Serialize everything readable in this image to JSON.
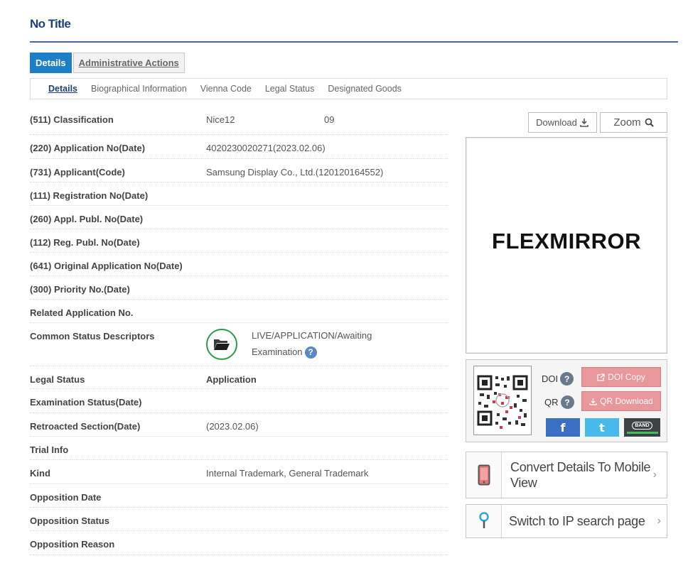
{
  "page": {
    "title": "No Title"
  },
  "main_tabs": [
    {
      "label": "Details"
    },
    {
      "label": "Administrative Actions"
    }
  ],
  "sub_tabs": [
    {
      "label": "Details"
    },
    {
      "label": "Biographical Information"
    },
    {
      "label": "Vienna Code"
    },
    {
      "label": "Legal Status"
    },
    {
      "label": "Designated Goods"
    }
  ],
  "rows": [
    {
      "label": "(511) Classification",
      "value_a": "Nice12",
      "value_b": "09"
    },
    {
      "label": "(220) Application No(Date)",
      "value": "4020230020271(2023.02.06)"
    },
    {
      "label": "(731) Applicant(Code)",
      "value": "Samsung Display Co., Ltd.(120120164552)"
    },
    {
      "label": "(111) Registration No(Date)",
      "value": ""
    },
    {
      "label": "(260) Appl. Publ. No(Date)",
      "value": ""
    },
    {
      "label": "(112) Reg. Publ. No(Date)",
      "value": ""
    },
    {
      "label": "(641) Original Application No(Date)",
      "value": ""
    },
    {
      "label": "(300) Priority No.(Date)",
      "value": ""
    },
    {
      "label": "Related Application No.",
      "value": ""
    },
    {
      "label": "Common Status Descriptors",
      "value": "LIVE/APPLICATION/Awaiting Examination"
    },
    {
      "label": "Legal Status",
      "value": "Application"
    },
    {
      "label": "Examination Status(Date)",
      "value": ""
    },
    {
      "label": "Retroacted Section(Date)",
      "value": "(2023.02.06)"
    },
    {
      "label": "Trial Info",
      "value": ""
    },
    {
      "label": "Kind",
      "value": "Internal Trademark, General Trademark"
    },
    {
      "label": "Opposition Date",
      "value": ""
    },
    {
      "label": "Opposition Status",
      "value": ""
    },
    {
      "label": "Opposition Reason",
      "value": ""
    }
  ],
  "right": {
    "download_label": "Download",
    "zoom_label": "Zoom",
    "mark_text": "FLEXMIRROR",
    "doi_label": "DOI",
    "qr_label": "QR",
    "doi_copy_label": "DOI Copy",
    "qr_download_label": "QR Download",
    "band_label": "BAND",
    "mobile_link": "Convert Details To Mobile View",
    "ip_link": "Switch to IP search page"
  },
  "colors": {
    "title": "#1d3f7a",
    "active_tab": "#1f7fc6",
    "status_ring": "#2a9a4a",
    "pink_button": "#e8979b",
    "facebook": "#3b6fc4",
    "twitter": "#49b8ea",
    "band": "#3f4144"
  }
}
